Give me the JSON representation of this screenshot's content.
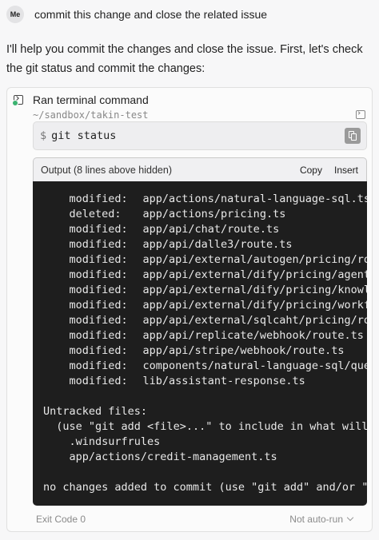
{
  "user": {
    "avatar_initials": "Me",
    "message": "commit this change and close the related issue"
  },
  "assistant": {
    "text": "I'll help you commit the changes and close the issue. First, let's check the git status and commit the changes:"
  },
  "tool": {
    "title": "Ran terminal command",
    "icon": "terminal-icon",
    "cwd": "~/sandbox/takin-test",
    "prompt": "$",
    "command": "git status",
    "output_label": "Output (8 lines above hidden)",
    "copy_label": "Copy",
    "insert_label": "Insert",
    "output_lines": [
      {
        "indent": "    ",
        "key": "modified:",
        "path": "app/actions/natural-language-sql.ts"
      },
      {
        "indent": "    ",
        "key": "deleted:",
        "path": "app/actions/pricing.ts"
      },
      {
        "indent": "    ",
        "key": "modified:",
        "path": "app/api/chat/route.ts"
      },
      {
        "indent": "    ",
        "key": "modified:",
        "path": "app/api/dalle3/route.ts"
      },
      {
        "indent": "    ",
        "key": "modified:",
        "path": "app/api/external/autogen/pricing/route.ts"
      },
      {
        "indent": "    ",
        "key": "modified:",
        "path": "app/api/external/dify/pricing/agent/route.ts"
      },
      {
        "indent": "    ",
        "key": "modified:",
        "path": "app/api/external/dify/pricing/knowledge/route.ts"
      },
      {
        "indent": "    ",
        "key": "modified:",
        "path": "app/api/external/dify/pricing/workflow/route.ts"
      },
      {
        "indent": "    ",
        "key": "modified:",
        "path": "app/api/external/sqlcaht/pricing/route.ts"
      },
      {
        "indent": "    ",
        "key": "modified:",
        "path": "app/api/replicate/webhook/route.ts"
      },
      {
        "indent": "    ",
        "key": "modified:",
        "path": "app/api/stripe/webhook/route.ts"
      },
      {
        "indent": "    ",
        "key": "modified:",
        "path": "components/natural-language-sql/query.tsx"
      },
      {
        "indent": "    ",
        "key": "modified:",
        "path": "lib/assistant-response.ts"
      },
      {
        "indent": "",
        "key": "",
        "path": ""
      },
      {
        "indent": "",
        "key": "",
        "path": "Untracked files:"
      },
      {
        "indent": "  ",
        "key": "",
        "path": "(use \"git add <file>...\" to include in what will be committed)"
      },
      {
        "indent": "    ",
        "key": "",
        "path": ".windsurfrules"
      },
      {
        "indent": "    ",
        "key": "",
        "path": "app/actions/credit-management.ts"
      },
      {
        "indent": "",
        "key": "",
        "path": ""
      },
      {
        "indent": "",
        "key": "",
        "path": "no changes added to commit (use \"git add\" and/or \"git commit -a\")"
      }
    ],
    "exit_code": "Exit Code 0",
    "auto_run": "Not auto-run"
  }
}
